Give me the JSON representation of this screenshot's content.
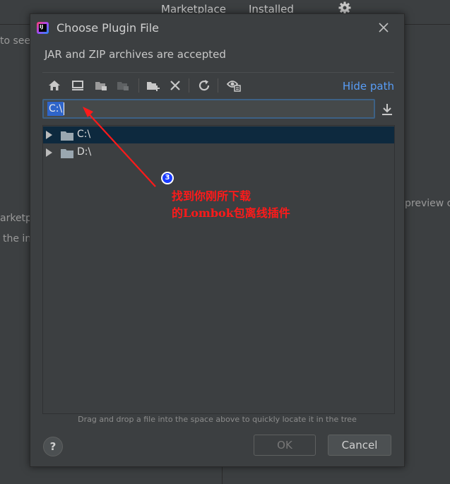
{
  "background": {
    "tabs": [
      "Marketplace",
      "Installed"
    ],
    "left_snippets": [
      "to see",
      "arketpl",
      "the in"
    ],
    "right_snippet": "preview c"
  },
  "dialog": {
    "title": "Choose Plugin File",
    "subtitle": "JAR and ZIP archives are accepted",
    "toolbar": {
      "buttons": [
        "home-icon",
        "desktop-icon",
        "project-icon",
        "module-icon",
        "new-folder-icon",
        "delete-icon",
        "refresh-icon",
        "show-hidden-icon"
      ],
      "hide_path_label": "Hide path"
    },
    "path_input": {
      "value": "C:\\"
    },
    "tree": [
      {
        "label": "C:\\",
        "selected": true
      },
      {
        "label": "D:\\",
        "selected": false
      }
    ],
    "hint": "Drag and drop a file into the space above to quickly locate it in the tree",
    "help_label": "?",
    "ok_label": "OK",
    "cancel_label": "Cancel"
  },
  "annotation": {
    "number": "3",
    "line1": "找到你刚所下载",
    "line2": "的Lombok包离线插件",
    "color": "#ff1a1a"
  }
}
